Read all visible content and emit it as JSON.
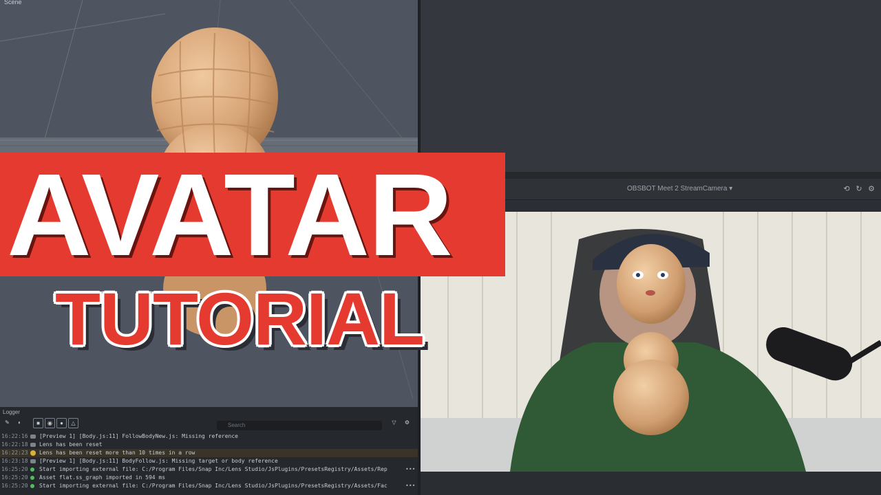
{
  "scene": {
    "label": "Scene"
  },
  "preview": {
    "camera_label": "OBSBOT Meet 2 StreamCamera",
    "icons": [
      "rotate-camera-icon",
      "reset-icon",
      "settings-icon"
    ]
  },
  "logger": {
    "title": "Logger",
    "search_placeholder": "Search",
    "rows": [
      {
        "time": "16:22:16",
        "level": "info",
        "text": "[Preview 1] [Body.js:11] FollowBodyNew.js: Missing reference"
      },
      {
        "time": "16:22:18",
        "level": "info",
        "text": "Lens has been reset"
      },
      {
        "time": "16:22:23",
        "level": "warning",
        "text": "Lens has been reset more than 10 times in a row"
      },
      {
        "time": "16:23:18",
        "level": "info",
        "text": "[Preview 1] [Body.js:11] BodyFollow.js: Missing target or body reference"
      },
      {
        "time": "16:25:20",
        "level": "success",
        "text": "Start importing external file: C:/Program Files/Snap Inc/Lens Studio/JsPlugins/PresetsRegistry/Assets/Rep",
        "more": "•••"
      },
      {
        "time": "16:25:20",
        "level": "success",
        "text": "Asset flat.ss_graph imported in 594 ms"
      },
      {
        "time": "16:25:20",
        "level": "success",
        "text": "Start importing external file: C:/Program Files/Snap Inc/Lens Studio/JsPlugins/PresetsRegistry/Assets/Fac",
        "more": "•••"
      }
    ]
  },
  "overlay": {
    "title": "AVATAR",
    "subtitle": "TUTORIAL"
  },
  "colors": {
    "accent_red": "#e53a2f",
    "panel_dark": "#25282d",
    "scene_bg": "#4f5560"
  }
}
